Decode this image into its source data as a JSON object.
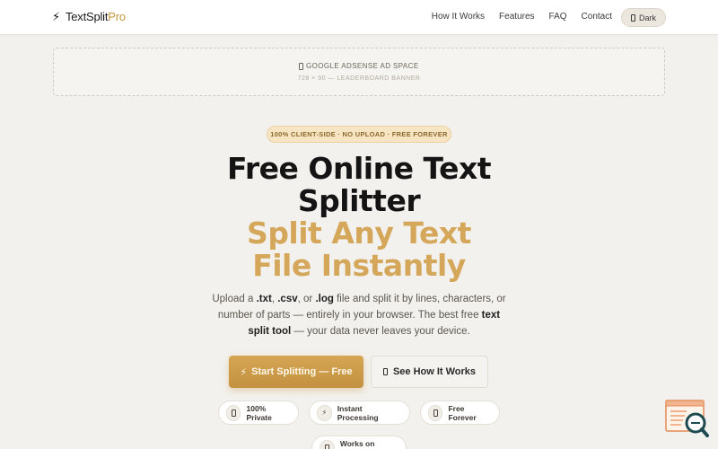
{
  "brand": {
    "logo_glyph": "⚡",
    "name_part1": "TextSplit",
    "name_part2": "Pro",
    "accent_color": "#c9973c"
  },
  "nav": {
    "links": [
      "How It Works",
      "Features",
      "FAQ",
      "Contact"
    ],
    "theme_toggle_label": "Dark"
  },
  "ad": {
    "title": "GOOGLE ADSENSE AD SPACE",
    "subtitle": "728 × 90 — LEADERBOARD BANNER"
  },
  "hero": {
    "badge": "100% CLIENT-SIDE · NO UPLOAD · FREE FOREVER",
    "title_line1": "Free Online Text",
    "title_line2": "Splitter",
    "accent_line1": "Split Any Text",
    "accent_line2": "File Instantly",
    "accent_color": "#d4a75b",
    "desc": {
      "p1": "Upload a ",
      "ext_txt": ".txt",
      "sep1": ", ",
      "ext_csv": ".csv",
      "sep2": ", or ",
      "ext_log": ".log",
      "p2": " file and split it by lines, characters, or number of parts — entirely in your browser. The best free ",
      "keyword": "text split tool",
      "p3": " — your data never leaves your device."
    }
  },
  "cta": {
    "primary_glyph": "⚡",
    "primary_label": "Start Splitting — Free",
    "secondary_label": "See How It Works"
  },
  "features": [
    {
      "label": "100% Private",
      "icon": "lock-icon"
    },
    {
      "label": "Instant Processing",
      "icon": "bolt-icon",
      "glyph": "⚡"
    },
    {
      "label": "Free Forever",
      "icon": "gift-icon"
    },
    {
      "label": "Works on Mobile",
      "icon": "mobile-icon"
    }
  ]
}
